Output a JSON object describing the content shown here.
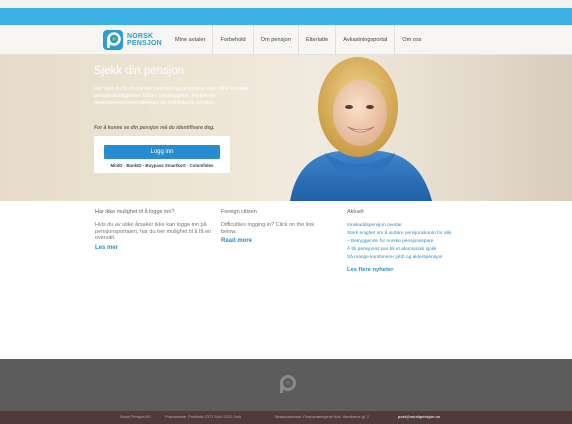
{
  "brand": {
    "line1": "NORSK",
    "line2": "PENSJON"
  },
  "nav": [
    {
      "label": "Mine avtaler"
    },
    {
      "label": "Forbehold"
    },
    {
      "label": "Om pensjon"
    },
    {
      "label": "Etterlatte"
    },
    {
      "label": "Avkastningsportal"
    },
    {
      "label": "Om oss"
    }
  ],
  "hero": {
    "title": "Sjekk din pensjon",
    "text": "Her kan du få en samlet oversikt og prognose over dine ansatte pensjonsrettigheter både i folketrygden, fra private tjenestepensjonsordninger og individuelle avtaler.",
    "note": "For å kunne se din pensjon må du identifisere deg.",
    "login_button": "Logg inn",
    "login_methods": "MinID · BankID · Buypass Smartkort · Commfides"
  },
  "columns": [
    {
      "heading": "Har ikke mulighet til å logge inn?",
      "text": "Hvis du av ulike årsaker ikke kan logge inn på pensjonsportalen, har du her mulighet til å få en oversikt.",
      "link": "Les mer"
    },
    {
      "heading": "Foreign citizen",
      "text": "Difficulties logging in? Click on the link below.",
      "link": "Read more"
    }
  ],
  "news": {
    "heading": "Aktuelt",
    "items": [
      "Innskuddspensjon overtar",
      "Sterk enighet om å innføre pensjonskonto for alle",
      "– Betryggende for norske pensjonsspare",
      "Å bli pensjonist kan bli et økonomisk sjokk",
      "Så mange kombinerer jobb og alderspensjon"
    ],
    "more": "Les flere nyheter"
  },
  "footer": {
    "company": "Norsk Pensjon AS",
    "postal": "Postadresse: Postboks 2371 Solli, 0201 Oslo",
    "visit": "Besøksadresse: Finansnæringens Hus, Hansteens gt. 2",
    "email": "post@norskpensjon.no"
  },
  "colors": {
    "brand_blue": "#2d9bd7",
    "top_bar": "#3bb0e3",
    "button_blue": "#2a8cd0",
    "footer_grey": "#5c5c5c",
    "bottom_bar": "#503a3a"
  }
}
